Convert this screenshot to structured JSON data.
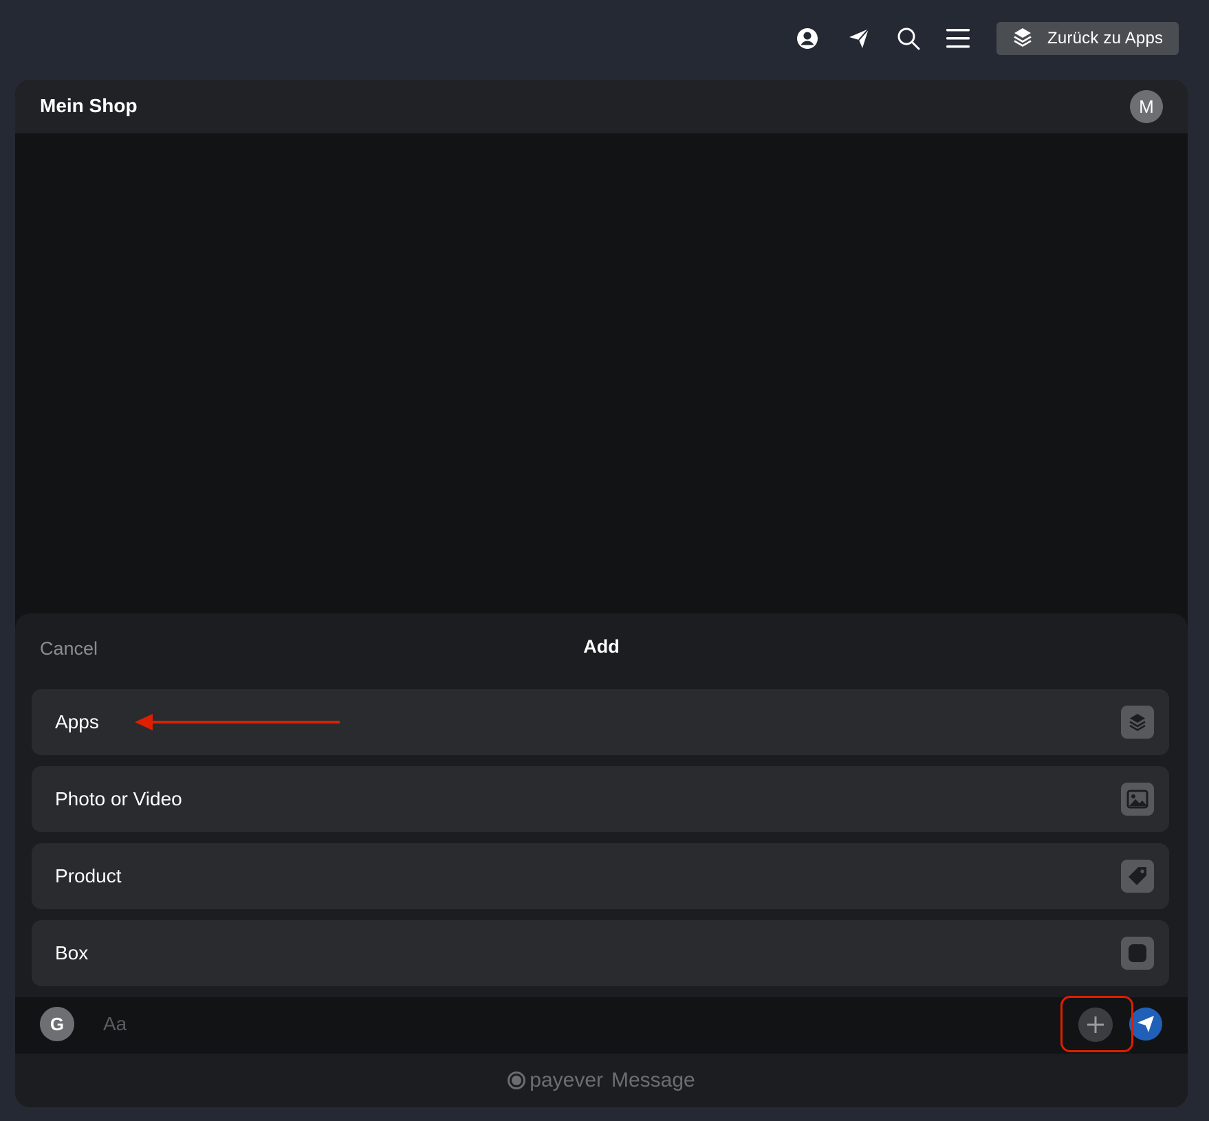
{
  "topbar": {
    "back_label": "Zurück zu Apps",
    "icons": [
      "account-icon",
      "send-icon",
      "search-icon",
      "menu-icon"
    ]
  },
  "panel": {
    "title": "Mein Shop",
    "avatar_initial": "M"
  },
  "sheet": {
    "cancel_label": "Cancel",
    "title": "Add",
    "options": [
      {
        "label": "Apps",
        "icon": "layers-icon"
      },
      {
        "label": "Photo or Video",
        "icon": "image-icon"
      },
      {
        "label": "Product",
        "icon": "tag-icon"
      },
      {
        "label": "Box",
        "icon": "square-icon"
      }
    ]
  },
  "composer": {
    "avatar_initial": "G",
    "placeholder": "Aa"
  },
  "footer": {
    "brand": "payever",
    "product": "Message"
  },
  "colors": {
    "background": "#252934",
    "panel": "#111314",
    "accent_send": "#2060b8",
    "annotation_red": "#e01e00"
  }
}
